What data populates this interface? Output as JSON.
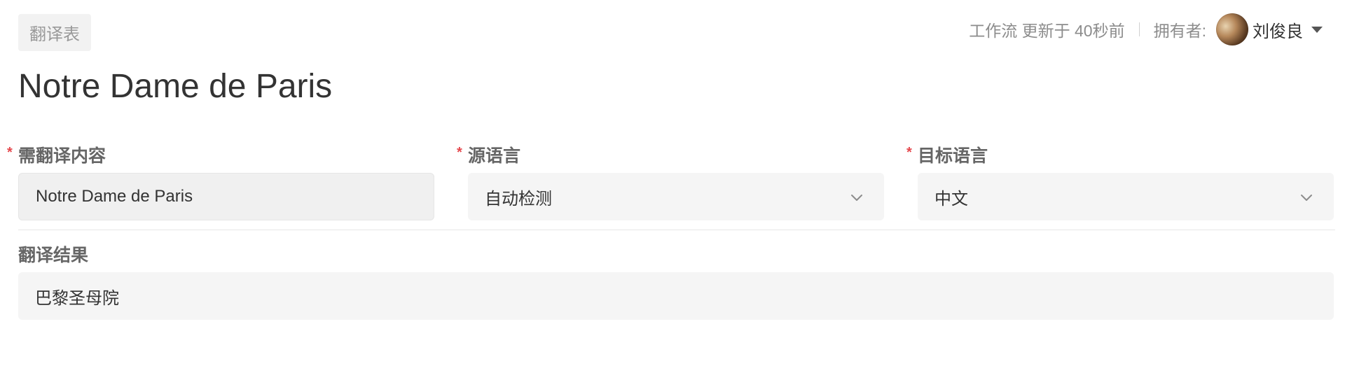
{
  "tag": {
    "label": "翻译表"
  },
  "meta": {
    "workflow_updated": "工作流 更新于 40秒前",
    "owner_label": "拥有者:",
    "owner_name": "刘俊良"
  },
  "page": {
    "title": "Notre Dame de Paris"
  },
  "fields": {
    "source_text": {
      "label": "需翻译内容",
      "required": "*",
      "value": "Notre Dame de Paris"
    },
    "source_lang": {
      "label": "源语言",
      "required": "*",
      "value": "自动检测"
    },
    "target_lang": {
      "label": "目标语言",
      "required": "*",
      "value": "中文"
    },
    "result": {
      "label": "翻译结果",
      "value": "巴黎圣母院"
    }
  },
  "colors": {
    "required": "#e5484d",
    "field_bg": "#f5f5f5",
    "muted_text": "#8c8c8c"
  }
}
